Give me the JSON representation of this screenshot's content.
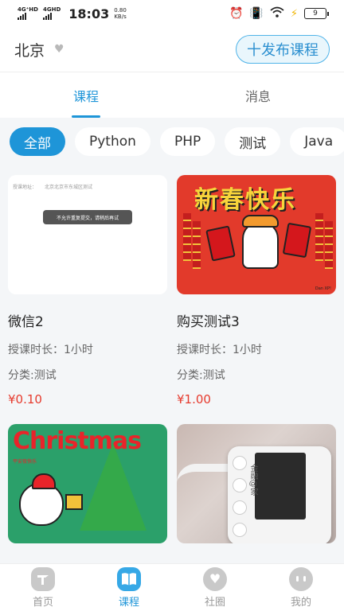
{
  "status_bar": {
    "network_1": "4G⁺HD",
    "network_2": "4GHD",
    "time": "18:03",
    "speed_value": "0.80",
    "speed_unit": "KB/s",
    "battery": "9"
  },
  "header": {
    "city": "北京",
    "publish_button": "十发布课程"
  },
  "tabs": [
    {
      "label": "课程",
      "active": true
    },
    {
      "label": "消息",
      "active": false
    }
  ],
  "filters": [
    {
      "label": "全部",
      "active": true
    },
    {
      "label": "Python",
      "active": false
    },
    {
      "label": "PHP",
      "active": false
    },
    {
      "label": "测试",
      "active": false
    },
    {
      "label": "Java",
      "active": false
    }
  ],
  "courses": [
    {
      "title": "微信2",
      "duration": "授课时长：1小时",
      "category": "分类:测试",
      "price": "¥0.10",
      "thumb_address_label": "授课地址：",
      "thumb_address_value": "北京北京市东城区测试",
      "thumb_toast": "不允许重复提交，请稍后再试"
    },
    {
      "title": "购买测试3",
      "duration": "授课时长：1小时",
      "category": "分类:测试",
      "price": "¥1.00",
      "thumb_text": "新春快乐",
      "thumb_sig": "Dan XP!"
    },
    {
      "thumb_text": "Christmas",
      "thumb_sub": "平安夜快乐"
    },
    {
      "thumb_text": "金融@家"
    }
  ],
  "tabbar": [
    {
      "label": "首页",
      "icon": "home-icon",
      "active": false
    },
    {
      "label": "课程",
      "icon": "book-icon",
      "active": true
    },
    {
      "label": "社圈",
      "icon": "heart-icon",
      "active": false
    },
    {
      "label": "我的",
      "icon": "profile-icon",
      "active": false
    }
  ],
  "colors": {
    "accent": "#1e95d8",
    "price": "#e63b2e",
    "background": "#f4f6f8"
  }
}
